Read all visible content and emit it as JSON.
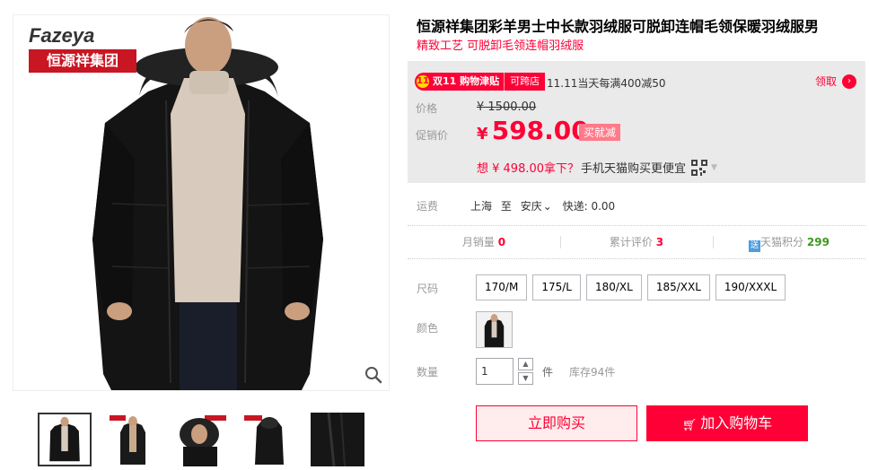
{
  "brand": {
    "logo_en": "Fazeya",
    "logo_cn": "恒源祥集团"
  },
  "product": {
    "title": "恒源祥集团彩羊男士中长款羽绒服可脱卸连帽毛领保暖羽绒服男",
    "subtitle": "精致工艺 可脱卸毛领连帽羽绒服"
  },
  "promo": {
    "badge_icon": "11",
    "badge_main": "双11 购物津贴",
    "badge_tag": "可跨店",
    "text": "11.11当天每满400减50",
    "coupon_label": "领取"
  },
  "price": {
    "orig_label": "价格",
    "orig_value": "¥ 1500.00",
    "promo_label": "促销价",
    "currency": "¥",
    "promo_value": "598.00",
    "buy_less_tag": "买就减",
    "mobile_highlight": "想 ¥ 498.00拿下？",
    "mobile_rest": "手机天猫购买更便宜"
  },
  "shipping": {
    "label": "运费",
    "from": "上海",
    "to_word": "至",
    "dest": "安庆",
    "express": "快递: 0.00"
  },
  "stats": {
    "monthly_sales_label": "月销量",
    "monthly_sales_value": "0",
    "reviews_label": "累计评价",
    "reviews_value": "3",
    "points_icon": "送",
    "points_label": "天猫积分",
    "points_value": "299"
  },
  "size": {
    "label": "尺码",
    "options": [
      "170/M",
      "175/L",
      "180/XL",
      "185/XXL",
      "190/XXXL"
    ]
  },
  "color": {
    "label": "颜色"
  },
  "quantity": {
    "label": "数量",
    "value": "1",
    "unit": "件",
    "stock": "库存94件"
  },
  "actions": {
    "buy_now": "立即购买",
    "add_cart": "加入购物车"
  }
}
